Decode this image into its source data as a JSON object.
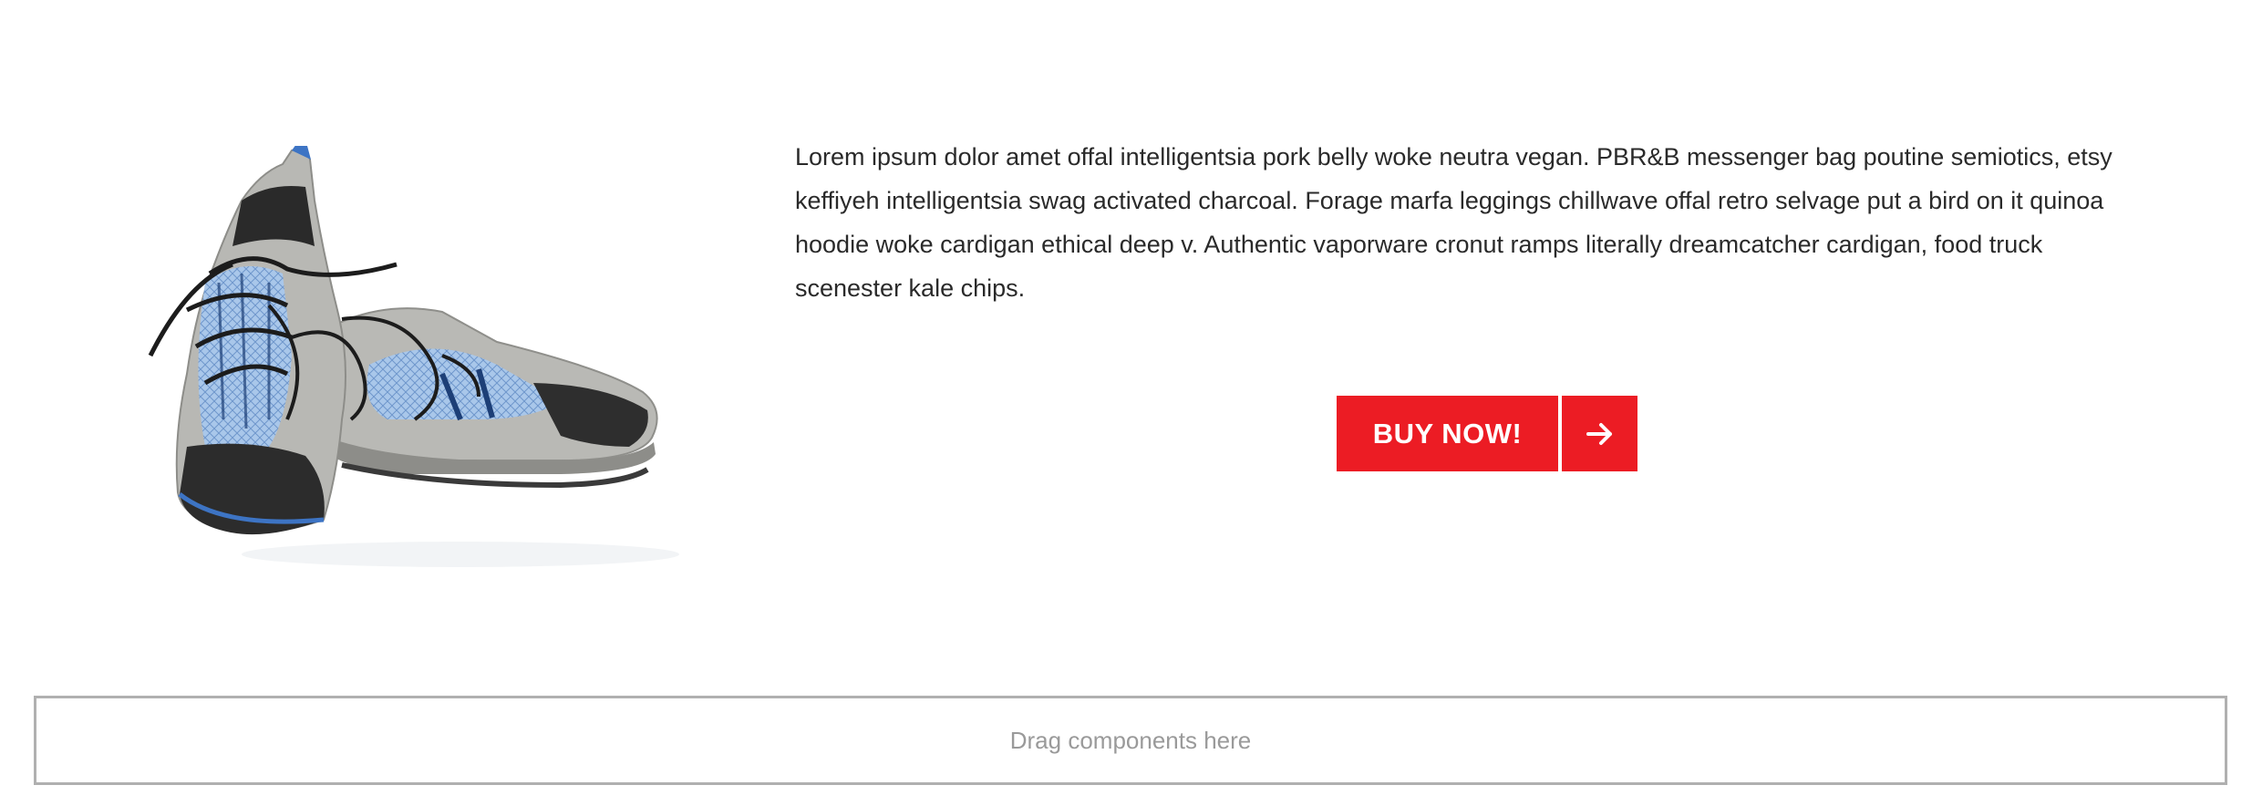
{
  "content": {
    "paragraph": "Lorem ipsum dolor amet offal intelligentsia pork belly woke neutra vegan. PBR&B messenger bag poutine semiotics, etsy keffiyeh intelligentsia swag activated charcoal. Forage marfa leggings chillwave offal retro selvage put a bird on it quinoa hoodie woke cardigan ethical deep v. Authentic vaporware cronut ramps literally dreamcatcher cardigan, food truck scenester kale chips."
  },
  "cta": {
    "label": "BUY NOW!",
    "arrow_icon": "arrow-right-icon",
    "color": "#ec1c24"
  },
  "dropzone": {
    "text": "Drag components here"
  },
  "image": {
    "subject": "sneakers-icon",
    "colors": {
      "mesh": "#a9c7ea",
      "accent": "#3d74c4",
      "gray": "#b6b6b2",
      "dark": "#2c2c2c"
    }
  }
}
